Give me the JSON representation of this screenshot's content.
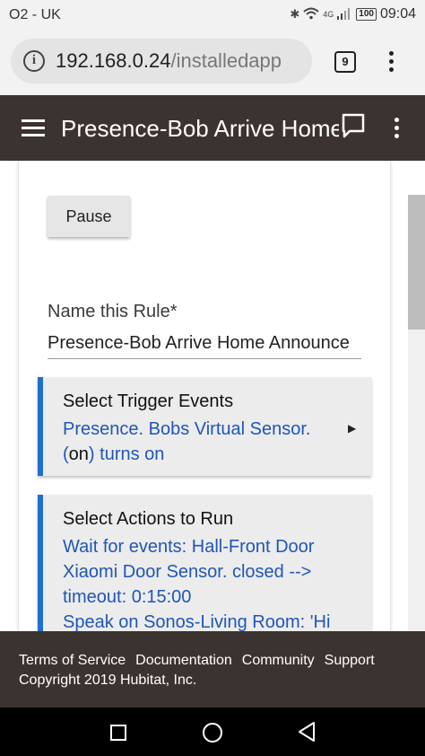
{
  "status_bar": {
    "carrier": "O2 - UK",
    "network": "4G",
    "battery": "100",
    "time": "09:04"
  },
  "browser": {
    "url_host": "192.168.0.24",
    "url_path": "/installedapp",
    "tab_count": "9"
  },
  "app_header": {
    "title": "Presence-Bob Arrive Home Announce"
  },
  "page": {
    "pause_label": "Pause",
    "rule_name_label": "Name this Rule*",
    "rule_name_value": "Presence-Bob Arrive Home Announce",
    "trigger": {
      "title": "Select Trigger Events",
      "desc_1": "Presence. Bobs Virtual Sensor.",
      "desc_2a": "(",
      "desc_2b": "on",
      "desc_2c": ") turns on"
    },
    "actions": {
      "title": "Select Actions to Run",
      "line_1": "Wait for events: Hall-Front Door",
      "line_2": "Xiaomi Door Sensor. closed -->",
      "line_3": "timeout: 0:15:00",
      "line_4": "Speak on Sonos-Living Room: 'Hi"
    }
  },
  "footer": {
    "terms": "Terms of Service",
    "documentation": "Documentation",
    "community": "Community",
    "support": "Support",
    "copyright": "Copyright 2019 Hubitat, Inc."
  },
  "colors": {
    "header_bg": "#3b3330",
    "accent_blue": "#1f6fd0",
    "link_blue": "#1f56b8"
  }
}
